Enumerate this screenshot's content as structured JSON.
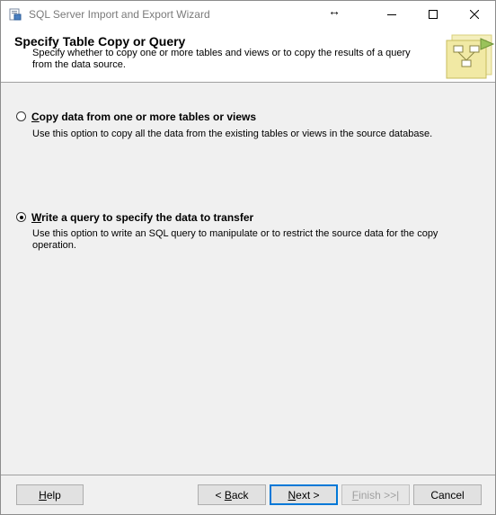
{
  "window": {
    "title": "SQL Server Import and Export Wizard"
  },
  "header": {
    "title": "Specify Table Copy or Query",
    "description": "Specify whether to copy one or more tables and views or to copy the results of a query from the data source."
  },
  "options": [
    {
      "label_prefix": "",
      "label_accel": "C",
      "label_rest": "opy data from one or more tables or views",
      "description": "Use this option to copy all the data from the existing tables or views in the source database.",
      "selected": false
    },
    {
      "label_prefix": "",
      "label_accel": "W",
      "label_rest": "rite a query to specify the data to transfer",
      "description": "Use this option to write an SQL query to manipulate or to restrict the source data for the copy operation.",
      "selected": true
    }
  ],
  "buttons": {
    "help": {
      "accel": "H",
      "rest": "elp"
    },
    "back": {
      "prefix": "< ",
      "accel": "B",
      "rest": "ack"
    },
    "next": {
      "accel": "N",
      "rest": "ext >"
    },
    "finish": {
      "accel": "F",
      "rest": "inish >>|"
    },
    "cancel": {
      "label": "Cancel"
    }
  },
  "icons": {
    "app": "wizard-app-icon",
    "resize": "resize-horizontal-cursor",
    "header_graphic": "wizard-flowchart-graphic"
  }
}
